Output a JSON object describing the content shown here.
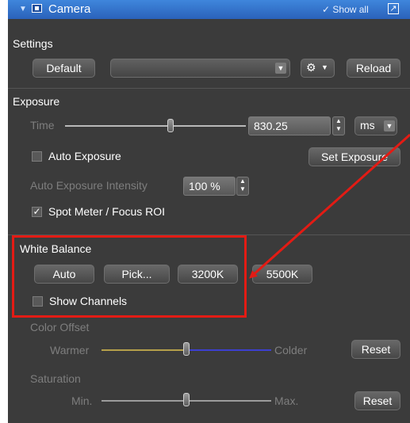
{
  "titlebar": {
    "title": "Camera",
    "show_all": "Show all"
  },
  "settings": {
    "heading": "Settings",
    "default_label": "Default",
    "preset_value": "",
    "reload_label": "Reload"
  },
  "exposure": {
    "heading": "Exposure",
    "time_label": "Time",
    "time_value": "830.25",
    "time_unit": "ms",
    "auto_exposure_label": "Auto Exposure",
    "auto_exposure_checked": false,
    "set_exposure_label": "Set Exposure",
    "intensity_label": "Auto Exposure Intensity",
    "intensity_value": "100 %",
    "spot_meter_label": "Spot Meter / Focus ROI",
    "spot_meter_checked": true
  },
  "white_balance": {
    "heading": "White Balance",
    "auto_label": "Auto",
    "pick_label": "Pick...",
    "k3200_label": "3200K",
    "k5500_label": "5500K",
    "show_channels_label": "Show Channels",
    "show_channels_checked": false
  },
  "color_offset": {
    "label": "Color Offset",
    "warmer_label": "Warmer",
    "colder_label": "Colder",
    "reset_label": "Reset"
  },
  "saturation": {
    "label": "Saturation",
    "min_label": "Min.",
    "max_label": "Max.",
    "reset_label": "Reset"
  },
  "annotation": {
    "color": "#e31b14"
  }
}
